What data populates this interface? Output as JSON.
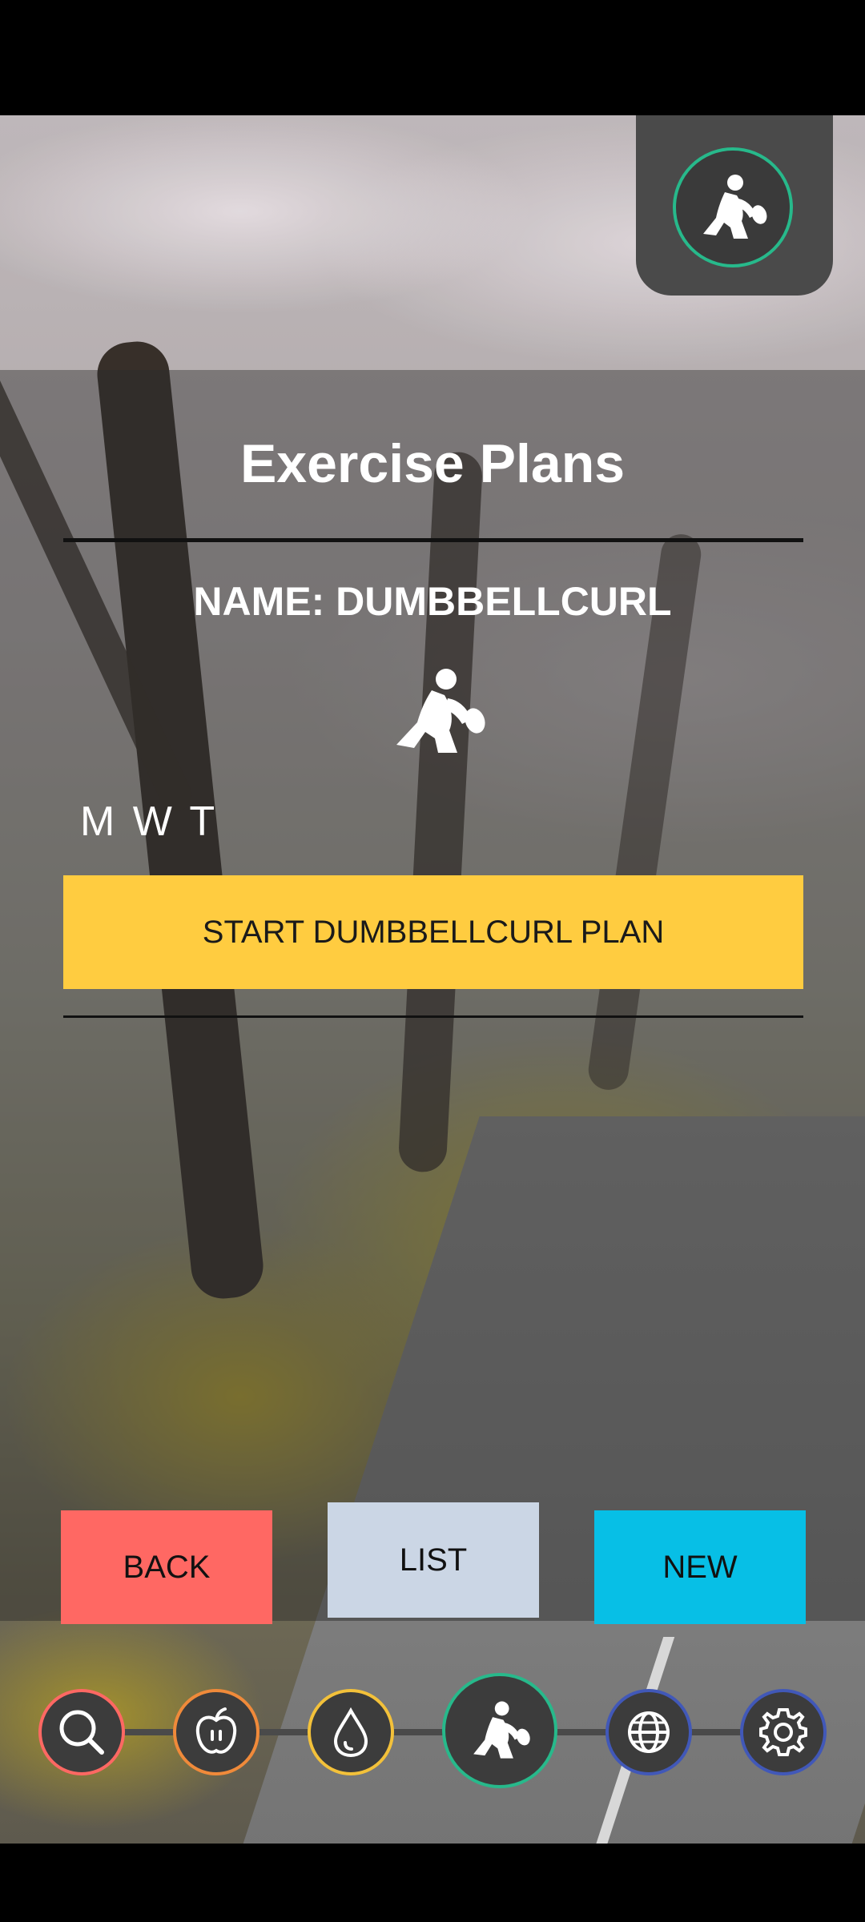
{
  "colors": {
    "accent_yellow": "#ffcc40",
    "back": "#ff6863",
    "list": "#cbd6e5",
    "new": "#07bfe6",
    "active_ring": "#27b98b",
    "search_ring": "#ff6863",
    "nutrition_ring": "#f08a3a",
    "water_ring": "#f3c13a",
    "globe_ring": "#4158b8",
    "settings_ring": "#4158b8"
  },
  "header": {
    "badge_icon": "weightlifter-icon"
  },
  "main": {
    "title": "Exercise Plans",
    "plan_name": "NAME: DUMBBELLCURL",
    "plan_icon": "weightlifter-icon",
    "days": "M W T",
    "start_label": "START DUMBBELLCURL PLAN"
  },
  "actions": {
    "back_label": "BACK",
    "list_label": "LIST",
    "new_label": "NEW"
  },
  "bottom_nav": {
    "items": [
      {
        "icon": "search-icon"
      },
      {
        "icon": "apple-icon"
      },
      {
        "icon": "water-drop-icon"
      },
      {
        "icon": "weightlifter-icon",
        "active": true
      },
      {
        "icon": "globe-icon"
      },
      {
        "icon": "gear-icon"
      }
    ]
  }
}
